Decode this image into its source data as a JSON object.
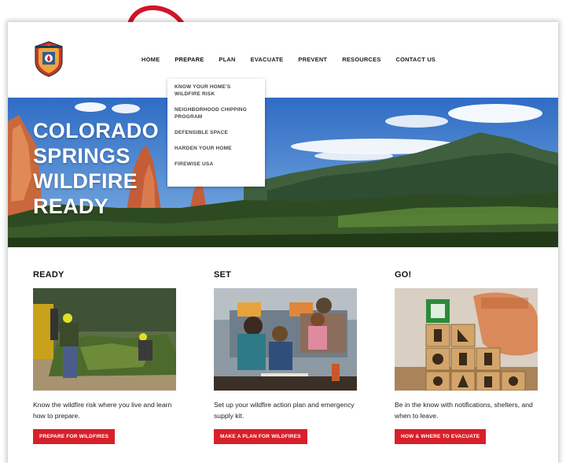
{
  "nav": {
    "items": [
      "HOME",
      "PREPARE",
      "PLAN",
      "EVACUATE",
      "PREVENT",
      "RESOURCES",
      "CONTACT US"
    ],
    "active": "PREPARE"
  },
  "dropdown": {
    "items": [
      "KNOW YOUR HOME'S WILDFIRE RISK",
      "NEIGHBORHOOD CHIPPING PROGRAM",
      "DEFENSIBLE SPACE",
      "HARDEN YOUR HOME",
      "FIREWISE USA"
    ]
  },
  "hero": {
    "title_lines": [
      "COLORADO",
      "SPRINGS",
      "WILDFIRE",
      "READY"
    ]
  },
  "columns": [
    {
      "heading": "READY",
      "text": "Know the wildfire risk where you live and learn how to prepare.",
      "button": "PREPARE FOR WILDFIRES"
    },
    {
      "heading": "SET",
      "text": "Set up your wildfire action plan and emergency supply kit.",
      "button": "MAKE A PLAN FOR WILDFIRES"
    },
    {
      "heading": "GO!",
      "text": "Be in the know with notifications, shelters, and when to leave.",
      "button": "HOW & WHERE TO EVACUATE"
    }
  ],
  "colors": {
    "accent": "#d8202b",
    "annotation_arrow": "#d3142a"
  }
}
